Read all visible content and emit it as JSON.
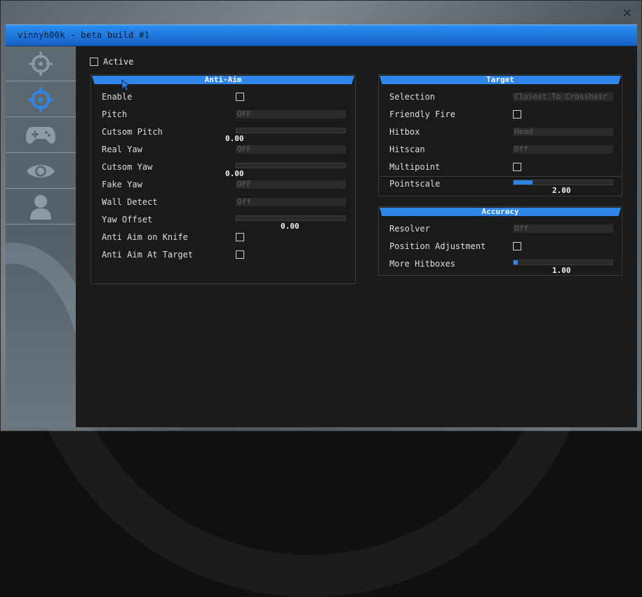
{
  "window": {
    "title": "vinnyh00k - beta build #1",
    "close": "✕"
  },
  "sidebar": {
    "tabs": [
      {
        "icon": "crosshair-icon"
      },
      {
        "icon": "crosshair-icon",
        "selected": true
      },
      {
        "icon": "gamepad-icon"
      },
      {
        "icon": "eye-icon"
      },
      {
        "icon": "user-icon"
      }
    ]
  },
  "main": {
    "active_label": "Active",
    "active_checked": false
  },
  "antiaim": {
    "header": "Anti-Aim",
    "enable": "Enable",
    "pitch": "Pitch",
    "pitch_value": "OFF",
    "custom_pitch": "Cutsom Pitch",
    "custom_pitch_value": "0.00",
    "real_yaw": "Real Yaw",
    "real_yaw_value": "OFF",
    "custom_yaw": "Cutsom Yaw",
    "custom_yaw_value": "0.00",
    "fake_yaw": "Fake Yaw",
    "fake_yaw_value": "OFF",
    "wall_detect": "Wall Detect",
    "wall_detect_value": "Off",
    "yaw_offset": "Yaw Offset",
    "yaw_offset_value": "0.00",
    "knife": "Anti Aim on Knife",
    "at_target": "Anti Aim At Target"
  },
  "target": {
    "header": "Target",
    "selection": "Selection",
    "selection_value": "Closest To Crosshair",
    "friendly_fire": "Friendly Fire",
    "hitbox": "Hitbox",
    "hitbox_value": "Head",
    "hitscan": "Hitscan",
    "hitscan_value": "Off",
    "multipoint": "Multipoint",
    "pointscale": "Pointscale",
    "pointscale_value": "2.00",
    "pointscale_fraction": 0.19
  },
  "accuracy": {
    "header": "Accuracy",
    "resolver": "Resolver",
    "resolver_value": "Off",
    "position_adjustment": "Position Adjustment",
    "more_hitboxes": "More Hitboxes",
    "more_hitboxes_value": "1.00",
    "more_hitboxes_fraction": 0.04
  },
  "colors": {
    "accent": "#2f86e8",
    "panel_bg": "#1a1a1a",
    "text": "#dedede"
  }
}
